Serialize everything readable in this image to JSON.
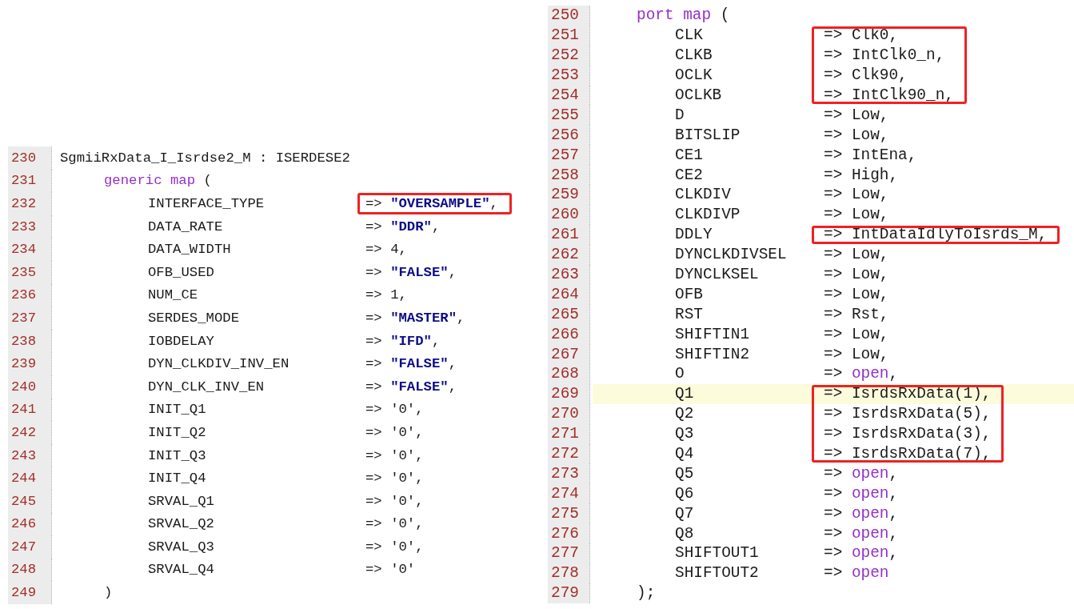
{
  "panels": [
    {
      "blocks": [
        {
          "boxed": false,
          "lines": [
            {
              "number": "230",
              "kind": "instance",
              "text": "SgmiiRxData_I_Isrdse2_M : ISERDESE2",
              "current": false
            },
            {
              "number": "231",
              "kind": "map_open",
              "keyword": "generic map",
              "text": "(",
              "current": false
            }
          ]
        },
        {
          "boxed": true,
          "lines": [
            {
              "number": "232",
              "kind": "mapping",
              "name": "INTERFACE_TYPE",
              "arrow": "=>",
              "value": {
                "text": "\"OVERSAMPLE\"",
                "kind": "string"
              },
              "punct": ",",
              "current": false
            }
          ]
        },
        {
          "boxed": false,
          "lines": [
            {
              "number": "233",
              "kind": "mapping",
              "name": "DATA_RATE",
              "arrow": "=>",
              "value": {
                "text": "\"DDR\"",
                "kind": "string"
              },
              "punct": ",",
              "current": false
            },
            {
              "number": "234",
              "kind": "mapping",
              "name": "DATA_WIDTH",
              "arrow": "=>",
              "value": {
                "text": "4",
                "kind": "plain"
              },
              "punct": ",",
              "current": false
            },
            {
              "number": "235",
              "kind": "mapping",
              "name": "OFB_USED",
              "arrow": "=>",
              "value": {
                "text": "\"FALSE\"",
                "kind": "string"
              },
              "punct": ",",
              "current": false
            },
            {
              "number": "236",
              "kind": "mapping",
              "name": "NUM_CE",
              "arrow": "=>",
              "value": {
                "text": "1",
                "kind": "plain"
              },
              "punct": ",",
              "current": false
            },
            {
              "number": "237",
              "kind": "mapping",
              "name": "SERDES_MODE",
              "arrow": "=>",
              "value": {
                "text": "\"MASTER\"",
                "kind": "string"
              },
              "punct": ",",
              "current": false
            },
            {
              "number": "238",
              "kind": "mapping",
              "name": "IOBDELAY",
              "arrow": "=>",
              "value": {
                "text": "\"IFD\"",
                "kind": "string"
              },
              "punct": ",",
              "current": false
            },
            {
              "number": "239",
              "kind": "mapping",
              "name": "DYN_CLKDIV_INV_EN",
              "arrow": "=>",
              "value": {
                "text": "\"FALSE\"",
                "kind": "string"
              },
              "punct": ",",
              "current": false
            },
            {
              "number": "240",
              "kind": "mapping",
              "name": "DYN_CLK_INV_EN",
              "arrow": "=>",
              "value": {
                "text": "\"FALSE\"",
                "kind": "string"
              },
              "punct": ",",
              "current": false
            },
            {
              "number": "241",
              "kind": "mapping",
              "name": "INIT_Q1",
              "arrow": "=>",
              "value": {
                "text": "'0'",
                "kind": "plain"
              },
              "punct": ",",
              "current": false
            },
            {
              "number": "242",
              "kind": "mapping",
              "name": "INIT_Q2",
              "arrow": "=>",
              "value": {
                "text": "'0'",
                "kind": "plain"
              },
              "punct": ",",
              "current": false
            },
            {
              "number": "243",
              "kind": "mapping",
              "name": "INIT_Q3",
              "arrow": "=>",
              "value": {
                "text": "'0'",
                "kind": "plain"
              },
              "punct": ",",
              "current": false
            },
            {
              "number": "244",
              "kind": "mapping",
              "name": "INIT_Q4",
              "arrow": "=>",
              "value": {
                "text": "'0'",
                "kind": "plain"
              },
              "punct": ",",
              "current": false
            },
            {
              "number": "245",
              "kind": "mapping",
              "name": "SRVAL_Q1",
              "arrow": "=>",
              "value": {
                "text": "'0'",
                "kind": "plain"
              },
              "punct": ",",
              "current": false
            },
            {
              "number": "246",
              "kind": "mapping",
              "name": "SRVAL_Q2",
              "arrow": "=>",
              "value": {
                "text": "'0'",
                "kind": "plain"
              },
              "punct": ",",
              "current": false
            },
            {
              "number": "247",
              "kind": "mapping",
              "name": "SRVAL_Q3",
              "arrow": "=>",
              "value": {
                "text": "'0'",
                "kind": "plain"
              },
              "punct": ",",
              "current": false
            },
            {
              "number": "248",
              "kind": "mapping",
              "name": "SRVAL_Q4",
              "arrow": "=>",
              "value": {
                "text": "'0'",
                "kind": "plain"
              },
              "current": false
            },
            {
              "number": "249",
              "kind": "map_close",
              "text": ")",
              "current": false
            }
          ]
        }
      ]
    },
    {
      "blocks": [
        {
          "boxed": false,
          "lines": [
            {
              "number": "250",
              "kind": "map_open",
              "keyword": "port map",
              "text": "(",
              "current": false
            }
          ]
        },
        {
          "boxed": true,
          "lines": [
            {
              "number": "251",
              "kind": "mapping",
              "name": "CLK",
              "arrow": "=>",
              "value": {
                "text": "Clk0",
                "kind": "plain"
              },
              "punct": ",",
              "current": false
            },
            {
              "number": "252",
              "kind": "mapping",
              "name": "CLKB",
              "arrow": "=>",
              "value": {
                "text": "IntClk0_n",
                "kind": "plain"
              },
              "punct": ",",
              "current": false
            },
            {
              "number": "253",
              "kind": "mapping",
              "name": "OCLK",
              "arrow": "=>",
              "value": {
                "text": "Clk90",
                "kind": "plain"
              },
              "punct": ",",
              "current": false
            },
            {
              "number": "254",
              "kind": "mapping",
              "name": "OCLKB",
              "arrow": "=>",
              "value": {
                "text": "IntClk90_n",
                "kind": "plain"
              },
              "punct": ",",
              "current": false
            }
          ]
        },
        {
          "boxed": false,
          "lines": [
            {
              "number": "255",
              "kind": "mapping",
              "name": "D",
              "arrow": "=>",
              "value": {
                "text": "Low",
                "kind": "plain"
              },
              "punct": ",",
              "current": false
            },
            {
              "number": "256",
              "kind": "mapping",
              "name": "BITSLIP",
              "arrow": "=>",
              "value": {
                "text": "Low",
                "kind": "plain"
              },
              "punct": ",",
              "current": false
            },
            {
              "number": "257",
              "kind": "mapping",
              "name": "CE1",
              "arrow": "=>",
              "value": {
                "text": "IntEna",
                "kind": "plain"
              },
              "punct": ",",
              "current": false
            },
            {
              "number": "258",
              "kind": "mapping",
              "name": "CE2",
              "arrow": "=>",
              "value": {
                "text": "High",
                "kind": "plain"
              },
              "punct": ",",
              "current": false
            },
            {
              "number": "259",
              "kind": "mapping",
              "name": "CLKDIV",
              "arrow": "=>",
              "value": {
                "text": "Low",
                "kind": "plain"
              },
              "punct": ",",
              "current": false
            },
            {
              "number": "260",
              "kind": "mapping",
              "name": "CLKDIVP",
              "arrow": "=>",
              "value": {
                "text": "Low",
                "kind": "plain"
              },
              "punct": ",",
              "current": false
            }
          ]
        },
        {
          "boxed": true,
          "lines": [
            {
              "number": "261",
              "kind": "mapping",
              "name": "DDLY",
              "arrow": "=>",
              "value": {
                "text": "IntDataIdlyToIsrds_M",
                "kind": "plain"
              },
              "punct": ",",
              "current": false
            }
          ]
        },
        {
          "boxed": false,
          "lines": [
            {
              "number": "262",
              "kind": "mapping",
              "name": "DYNCLKDIVSEL",
              "arrow": "=>",
              "value": {
                "text": "Low",
                "kind": "plain"
              },
              "punct": ",",
              "current": false
            },
            {
              "number": "263",
              "kind": "mapping",
              "name": "DYNCLKSEL",
              "arrow": "=>",
              "value": {
                "text": "Low",
                "kind": "plain"
              },
              "punct": ",",
              "current": false
            },
            {
              "number": "264",
              "kind": "mapping",
              "name": "OFB",
              "arrow": "=>",
              "value": {
                "text": "Low",
                "kind": "plain"
              },
              "punct": ",",
              "current": false
            },
            {
              "number": "265",
              "kind": "mapping",
              "name": "RST",
              "arrow": "=>",
              "value": {
                "text": "Rst",
                "kind": "plain"
              },
              "punct": ",",
              "current": false
            },
            {
              "number": "266",
              "kind": "mapping",
              "name": "SHIFTIN1",
              "arrow": "=>",
              "value": {
                "text": "Low",
                "kind": "plain"
              },
              "punct": ",",
              "current": false
            },
            {
              "number": "267",
              "kind": "mapping",
              "name": "SHIFTIN2",
              "arrow": "=>",
              "value": {
                "text": "Low",
                "kind": "plain"
              },
              "punct": ",",
              "current": false
            },
            {
              "number": "268",
              "kind": "mapping",
              "name": "O",
              "arrow": "=>",
              "value": {
                "text": "open",
                "kind": "keyword"
              },
              "punct": ",",
              "current": false
            }
          ]
        },
        {
          "boxed": true,
          "lines": [
            {
              "number": "269",
              "kind": "mapping",
              "name": "Q1",
              "arrow": "=>",
              "value": {
                "text": "IsrdsRxData(1)",
                "kind": "plain"
              },
              "punct": ",",
              "current": true
            },
            {
              "number": "270",
              "kind": "mapping",
              "name": "Q2",
              "arrow": "=>",
              "value": {
                "text": "IsrdsRxData(5)",
                "kind": "plain"
              },
              "punct": ",",
              "current": false
            },
            {
              "number": "271",
              "kind": "mapping",
              "name": "Q3",
              "arrow": "=>",
              "value": {
                "text": "IsrdsRxData(3)",
                "kind": "plain"
              },
              "punct": ",",
              "current": false
            },
            {
              "number": "272",
              "kind": "mapping",
              "name": "Q4",
              "arrow": "=>",
              "value": {
                "text": "IsrdsRxData(7)",
                "kind": "plain"
              },
              "punct": ",",
              "current": false
            }
          ]
        },
        {
          "boxed": false,
          "lines": [
            {
              "number": "273",
              "kind": "mapping",
              "name": "Q5",
              "arrow": "=>",
              "value": {
                "text": "open",
                "kind": "keyword"
              },
              "punct": ",",
              "current": false
            },
            {
              "number": "274",
              "kind": "mapping",
              "name": "Q6",
              "arrow": "=>",
              "value": {
                "text": "open",
                "kind": "keyword"
              },
              "punct": ",",
              "current": false
            },
            {
              "number": "275",
              "kind": "mapping",
              "name": "Q7",
              "arrow": "=>",
              "value": {
                "text": "open",
                "kind": "keyword"
              },
              "punct": ",",
              "current": false
            },
            {
              "number": "276",
              "kind": "mapping",
              "name": "Q8",
              "arrow": "=>",
              "value": {
                "text": "open",
                "kind": "keyword"
              },
              "punct": ",",
              "current": false
            },
            {
              "number": "277",
              "kind": "mapping",
              "name": "SHIFTOUT1",
              "arrow": "=>",
              "value": {
                "text": "open",
                "kind": "keyword"
              },
              "punct": ",",
              "current": false
            },
            {
              "number": "278",
              "kind": "mapping",
              "name": "SHIFTOUT2",
              "arrow": "=>",
              "value": {
                "text": "open",
                "kind": "keyword"
              },
              "current": false
            },
            {
              "number": "279",
              "kind": "map_close",
              "text": ");",
              "current": false
            }
          ]
        }
      ]
    }
  ]
}
